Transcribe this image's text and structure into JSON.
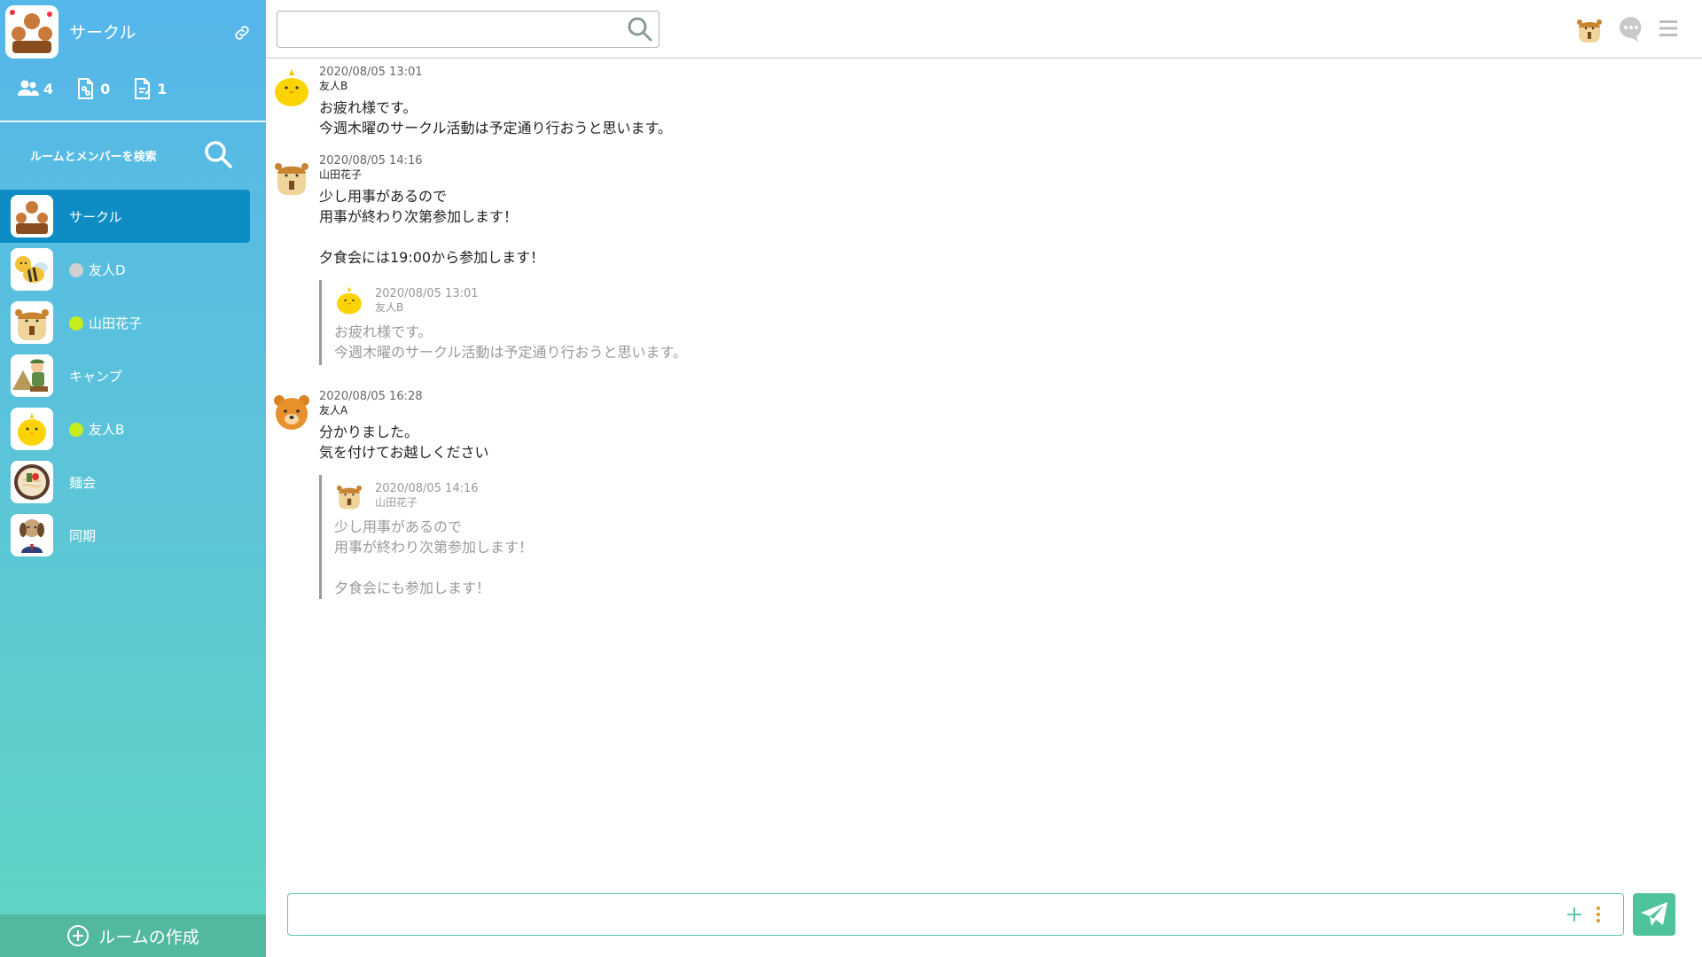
{
  "sidebar": {
    "room_title": "サークル",
    "stats": {
      "members": "4",
      "files": "0",
      "notes": "1"
    },
    "search_label": "ルームとメンバーを検索",
    "rooms": [
      {
        "name": "サークル",
        "status": ""
      },
      {
        "name": "友人D",
        "status": "offline"
      },
      {
        "name": "山田花子",
        "status": "online"
      },
      {
        "name": "キャンプ",
        "status": ""
      },
      {
        "name": "友人B",
        "status": "online"
      },
      {
        "name": "麺会",
        "status": ""
      },
      {
        "name": "同期",
        "status": ""
      }
    ],
    "create_room_label": "ルームの作成"
  },
  "topbar": {
    "search_value": "",
    "search_placeholder": ""
  },
  "messages": [
    {
      "time": "2020/08/05 13:01",
      "user": "友人B",
      "lines": [
        "お疲れ様です。",
        "今週木曜のサークル活動は予定通り行おうと思います。"
      ]
    },
    {
      "time": "2020/08/05 14:16",
      "user": "山田花子",
      "lines": [
        "少し用事があるので",
        "用事が終わり次第参加します！",
        "",
        "夕食会には19:00から参加します！"
      ],
      "quote": {
        "time": "2020/08/05 13:01",
        "user": "友人B",
        "lines": [
          "お疲れ様です。",
          "今週木曜のサークル活動は予定通り行おうと思います。"
        ]
      }
    },
    {
      "time": "2020/08/05 16:28",
      "user": "友人A",
      "lines": [
        "分かりました。",
        "気を付けてお越しください"
      ],
      "quote": {
        "time": "2020/08/05 14:16",
        "user": "山田花子",
        "lines": [
          "少し用事があるので",
          "用事が終わり次第参加します！",
          "",
          "夕食会にも参加します！"
        ]
      }
    }
  ],
  "composer": {
    "value": "",
    "placeholder": ""
  },
  "colors": {
    "sidebar_top": "#55b6ea",
    "sidebar_bottom": "#5fd6c2",
    "active_room": "#0e8cc4",
    "online_dot": "#c6ee1a",
    "offline_dot": "#d0d0d0",
    "send_button": "#4fc39b"
  }
}
